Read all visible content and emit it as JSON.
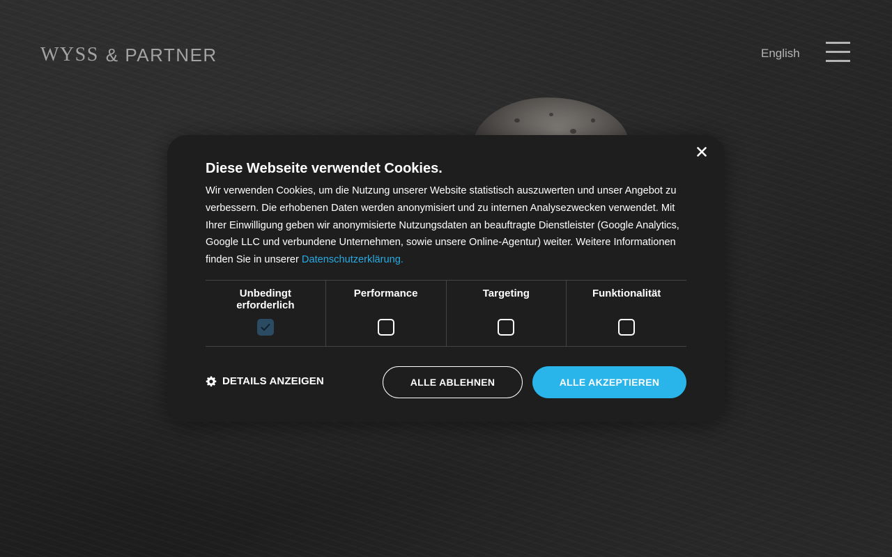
{
  "header": {
    "logo_primary": "WYSS",
    "logo_secondary": "& PARTNER",
    "language_link": "English",
    "menu_icon": "hamburger-menu-icon"
  },
  "cookie_dialog": {
    "close_icon": "close-icon",
    "title": "Diese Webseite verwendet Cookies.",
    "text": "Wir verwenden Cookies, um die Nutzung unserer Website statistisch auszuwerten und unser Angebot zu verbessern. Die erhobenen Daten werden anonymisiert und zu internen Analysezwecken verwendet. Mit Ihrer Einwilligung geben wir anonymisierte Nutzungsdaten an beauftragte Dienstleister (Google Analytics, Google LLC und verbundene Unternehmen, sowie unsere Online-Agentur) weiter. Weitere Informationen finden Sie in unserer",
    "policy_link": "Datenschutzerklärung.",
    "categories": [
      {
        "label": "Unbedingt erforderlich",
        "checked": true,
        "locked": true
      },
      {
        "label": "Performance",
        "checked": false,
        "locked": false
      },
      {
        "label": "Targeting",
        "checked": false,
        "locked": false
      },
      {
        "label": "Funktionalität",
        "checked": false,
        "locked": false
      }
    ],
    "details_label": "DETAILS ANZEIGEN",
    "details_icon": "gear-icon",
    "reject_label": "ALLE ABLEHNEN",
    "accept_label": "ALLE AKZEPTIEREN",
    "accent_color": "#29b4ea"
  }
}
